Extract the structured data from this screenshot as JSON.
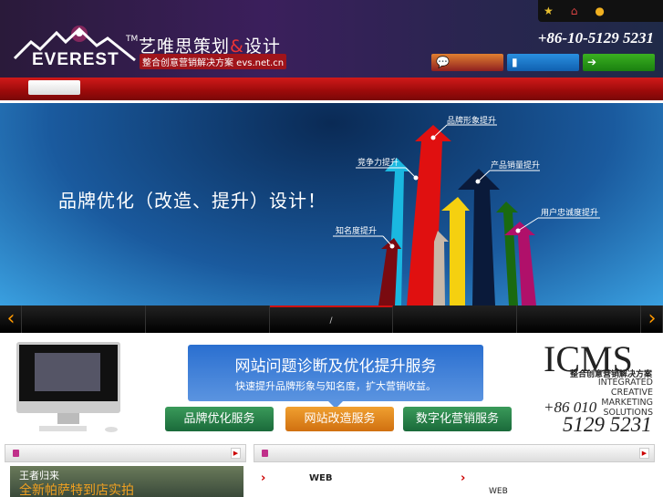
{
  "header": {
    "logo_text": "EVEREST",
    "tm": "TM",
    "brand_cn": "艺唯思策划",
    "brand_amp": "&",
    "brand_cn2": "设计",
    "brand_sub": "整合创意营销解决方案 evs.net.cn",
    "phone": "+86-10-5129 5231",
    "toplinks": [
      {
        "icon": "star-icon"
      },
      {
        "icon": "home-icon"
      },
      {
        "icon": "globe-icon"
      }
    ],
    "buttons": [
      {
        "icon": "chat-icon",
        "glyph": "💬",
        "color": "#b0501a"
      },
      {
        "icon": "chart-icon",
        "glyph": "▮",
        "color": "#1a78c8"
      },
      {
        "icon": "arrow-right-icon",
        "glyph": "➔",
        "color": "#2a9a18"
      }
    ]
  },
  "banner": {
    "title": "品牌优化（改造、提升）设计！",
    "labels": [
      "品牌形象提升",
      "竞争力提升",
      "产品销量提升",
      "用户忠诚度提升",
      "知名度提升"
    ]
  },
  "slider": {
    "prev": "‹",
    "next": "›",
    "thumbs": [
      "",
      "",
      "/",
      "",
      ""
    ]
  },
  "promo": {
    "title": "网站问题诊断及优化提升服务",
    "subtitle": "快速提升品牌形象与知名度，扩大营销收益。"
  },
  "services": [
    "品牌优化服务",
    "网站改造服务",
    "数字化营销服务"
  ],
  "icms": {
    "title": "ICMS",
    "sub": "整合创意营销解决方案",
    "en": [
      "INTEGRATED",
      "CREATIVE",
      "MARKETING",
      "SOLUTIONS"
    ],
    "phone1": "+86 010",
    "phone2": "5129 5231"
  },
  "news": {
    "image_caption1": "王者归来",
    "image_caption2": "全新帕萨特到店实拍",
    "items": [
      "WEB",
      "WEB"
    ]
  },
  "colors": {
    "nav_red": "#c01414",
    "promo_blue": "#2a6fd0",
    "svc_green": "#2a8a4a",
    "svc_orange": "#e08a1a"
  }
}
